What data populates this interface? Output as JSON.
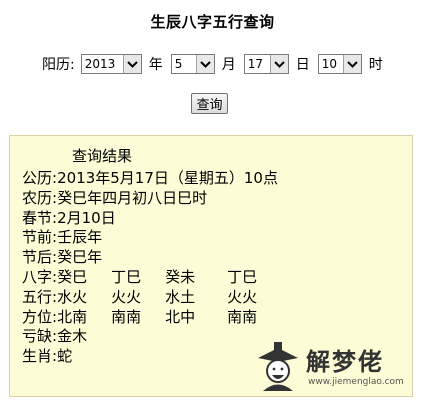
{
  "page": {
    "title": "生辰八字五行查询"
  },
  "form": {
    "calendar_label": "阳历:",
    "year": {
      "value": "2013",
      "unit": "年"
    },
    "month": {
      "value": "5",
      "unit": "月"
    },
    "day": {
      "value": "17",
      "unit": "日"
    },
    "hour": {
      "value": "10",
      "unit": "时"
    },
    "submit_label": "查询"
  },
  "result": {
    "title": "查询结果",
    "solar": {
      "label": "公历:",
      "value": "2013年5月17日（星期五）10点"
    },
    "lunar": {
      "label": "农历:",
      "value": "癸巳年四月初八日巳时"
    },
    "spring_festival": {
      "label": "春节:",
      "value": "2月10日"
    },
    "before_jieqi": {
      "label": "节前:",
      "value": "壬辰年"
    },
    "after_jieqi": {
      "label": "节后:",
      "value": "癸巳年"
    },
    "bazi": {
      "label": "八字:",
      "values": [
        "癸巳",
        "丁巳",
        "癸未",
        "丁巳"
      ]
    },
    "wuxing": {
      "label": "五行:",
      "values": [
        "水火",
        "火火",
        "水土",
        "火火"
      ]
    },
    "direction": {
      "label": "方位:",
      "values": [
        "北南",
        "南南",
        "北中",
        "南南"
      ]
    },
    "missing": {
      "label": "亏缺:",
      "value": "金木"
    },
    "zodiac": {
      "label": "生肖:",
      "value": "蛇"
    }
  },
  "watermark": {
    "logo_icon": "fortune-teller-logo-icon",
    "brand": "解梦佬",
    "url": "www.jiemenglao.com"
  }
}
